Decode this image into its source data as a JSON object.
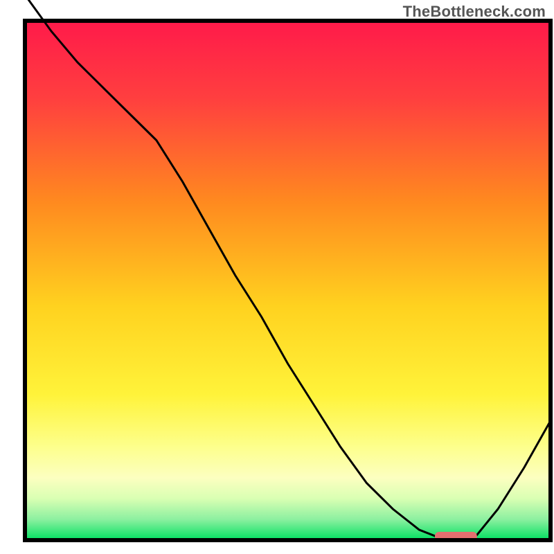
{
  "watermark": "TheBottleneck.com",
  "chart_data": {
    "type": "line",
    "title": "",
    "xlabel": "",
    "ylabel": "",
    "xlim": [
      0,
      100
    ],
    "ylim": [
      0,
      100
    ],
    "series": [
      {
        "name": "bottleneck-curve",
        "x": [
          0,
          5,
          10,
          15,
          20,
          25,
          30,
          35,
          40,
          45,
          50,
          55,
          60,
          65,
          70,
          75,
          80,
          82,
          84,
          86,
          90,
          95,
          100
        ],
        "y": [
          105,
          98,
          92,
          87,
          82,
          77,
          69,
          60,
          51,
          43,
          34,
          26,
          18,
          11,
          6,
          2,
          0,
          0,
          0,
          1,
          6,
          14,
          23
        ]
      }
    ],
    "marker": {
      "name": "optimal-zone",
      "x_start": 78,
      "x_end": 86,
      "y": 0,
      "color": "#e36f6f"
    },
    "gradient_stops": [
      {
        "offset": 0.0,
        "color": "#ff1a4a"
      },
      {
        "offset": 0.15,
        "color": "#ff3f3f"
      },
      {
        "offset": 0.35,
        "color": "#ff8a1f"
      },
      {
        "offset": 0.55,
        "color": "#ffd21f"
      },
      {
        "offset": 0.72,
        "color": "#fff33a"
      },
      {
        "offset": 0.82,
        "color": "#fdff8c"
      },
      {
        "offset": 0.88,
        "color": "#fcffc0"
      },
      {
        "offset": 0.92,
        "color": "#d9ffb3"
      },
      {
        "offset": 0.96,
        "color": "#8cf0a0"
      },
      {
        "offset": 1.0,
        "color": "#00e060"
      }
    ]
  }
}
